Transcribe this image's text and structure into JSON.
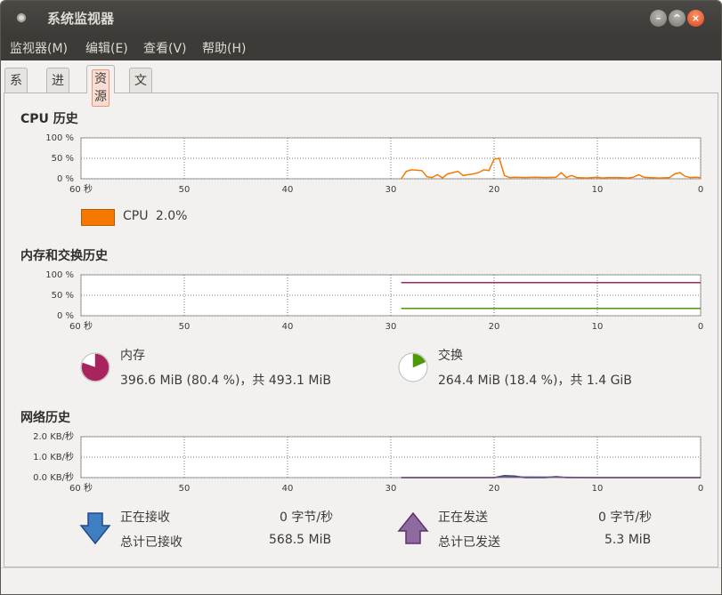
{
  "window": {
    "title": "系统监视器"
  },
  "menu": [
    {
      "label": "监视器(M)"
    },
    {
      "label": "编辑(E)"
    },
    {
      "label": "查看(V)"
    },
    {
      "label": "帮助(H)"
    }
  ],
  "tabs": [
    {
      "label": "系统",
      "active": false
    },
    {
      "label": "进程",
      "active": false
    },
    {
      "label": "资源",
      "active": true
    },
    {
      "label": "文件系统",
      "active": false
    }
  ],
  "x_ticks": [
    "60 秒",
    "50",
    "40",
    "30",
    "20",
    "10",
    "0"
  ],
  "cpu": {
    "title": "CPU 历史",
    "y_ticks": [
      "100 %",
      "50 %",
      "0 %"
    ],
    "legend_label": "CPU",
    "legend_value": "2.0%",
    "color": "#f57900",
    "chart_data": {
      "type": "line",
      "xlabel": "",
      "ylabel": "",
      "xlim": [
        60,
        0
      ],
      "ylim": [
        0,
        100
      ],
      "series": [
        {
          "name": "CPU",
          "x": [
            29,
            28.5,
            28,
            27,
            26.5,
            26,
            25.5,
            25,
            24.5,
            24,
            23.5,
            23,
            22.5,
            22,
            21.5,
            21,
            20.5,
            20,
            19.5,
            19,
            18.5,
            18,
            17,
            16,
            15,
            14,
            13.5,
            13,
            12.5,
            12,
            11,
            10,
            9.5,
            9,
            8,
            7,
            6.5,
            6,
            5.5,
            5,
            4,
            3,
            2.5,
            2,
            1.5,
            1,
            0.5,
            0
          ],
          "y": [
            0,
            18,
            22,
            20,
            5,
            3,
            10,
            2,
            12,
            15,
            18,
            8,
            10,
            12,
            15,
            22,
            20,
            48,
            50,
            8,
            3,
            4,
            3,
            4,
            3,
            4,
            15,
            3,
            8,
            3,
            2,
            4,
            2,
            3,
            3,
            2,
            4,
            10,
            4,
            3,
            2,
            3,
            12,
            15,
            6,
            3,
            4,
            3
          ]
        }
      ]
    }
  },
  "memory": {
    "title": "内存和交换历史",
    "y_ticks": [
      "100 %",
      "50 %",
      "0 %"
    ],
    "mem_label": "内存",
    "mem_value": "396.6 MiB (80.4 %)，共 493.1 MiB",
    "mem_fraction": 0.804,
    "mem_color": "#a8245e",
    "swap_label": "交换",
    "swap_value": "264.4 MiB (18.4 %)，共 1.4 GiB",
    "swap_fraction": 0.184,
    "swap_color": "#4e9a06",
    "chart_data": {
      "type": "line",
      "xlabel": "",
      "ylabel": "",
      "xlim": [
        60,
        0
      ],
      "ylim": [
        0,
        100
      ],
      "series": [
        {
          "name": "内存",
          "x": [
            29,
            20,
            10,
            0
          ],
          "y": [
            81,
            81,
            81,
            81
          ]
        },
        {
          "name": "交换",
          "x": [
            29,
            20,
            10,
            0
          ],
          "y": [
            18,
            18,
            18,
            18
          ]
        }
      ]
    }
  },
  "network": {
    "title": "网络历史",
    "y_ticks": [
      "2.0 KB/秒",
      "1.0 KB/秒",
      "0.0 KB/秒"
    ],
    "recv_label": "正在接收",
    "recv_rate": "0 字节/秒",
    "recv_total_label": "总计已接收",
    "recv_total": "568.5 MiB",
    "recv_color": "#204a87",
    "send_label": "正在发送",
    "send_rate": "0 字节/秒",
    "send_total_label": "总计已发送",
    "send_total": "5.3 MiB",
    "send_color": "#75507b",
    "chart_data": {
      "type": "line",
      "xlabel": "",
      "ylabel": "",
      "xlim": [
        60,
        0
      ],
      "ylim": [
        0,
        2.0
      ],
      "series": [
        {
          "name": "正在接收",
          "x": [
            29,
            20,
            19.5,
            19,
            18,
            17,
            15,
            14,
            13,
            10,
            0
          ],
          "y": [
            0,
            0,
            0.05,
            0.1,
            0.08,
            0,
            0,
            0.05,
            0,
            0,
            0
          ]
        },
        {
          "name": "正在发送",
          "x": [
            29,
            20,
            19,
            18,
            14,
            10,
            0
          ],
          "y": [
            0,
            0,
            0.05,
            0.03,
            0.02,
            0,
            0
          ]
        }
      ]
    }
  }
}
